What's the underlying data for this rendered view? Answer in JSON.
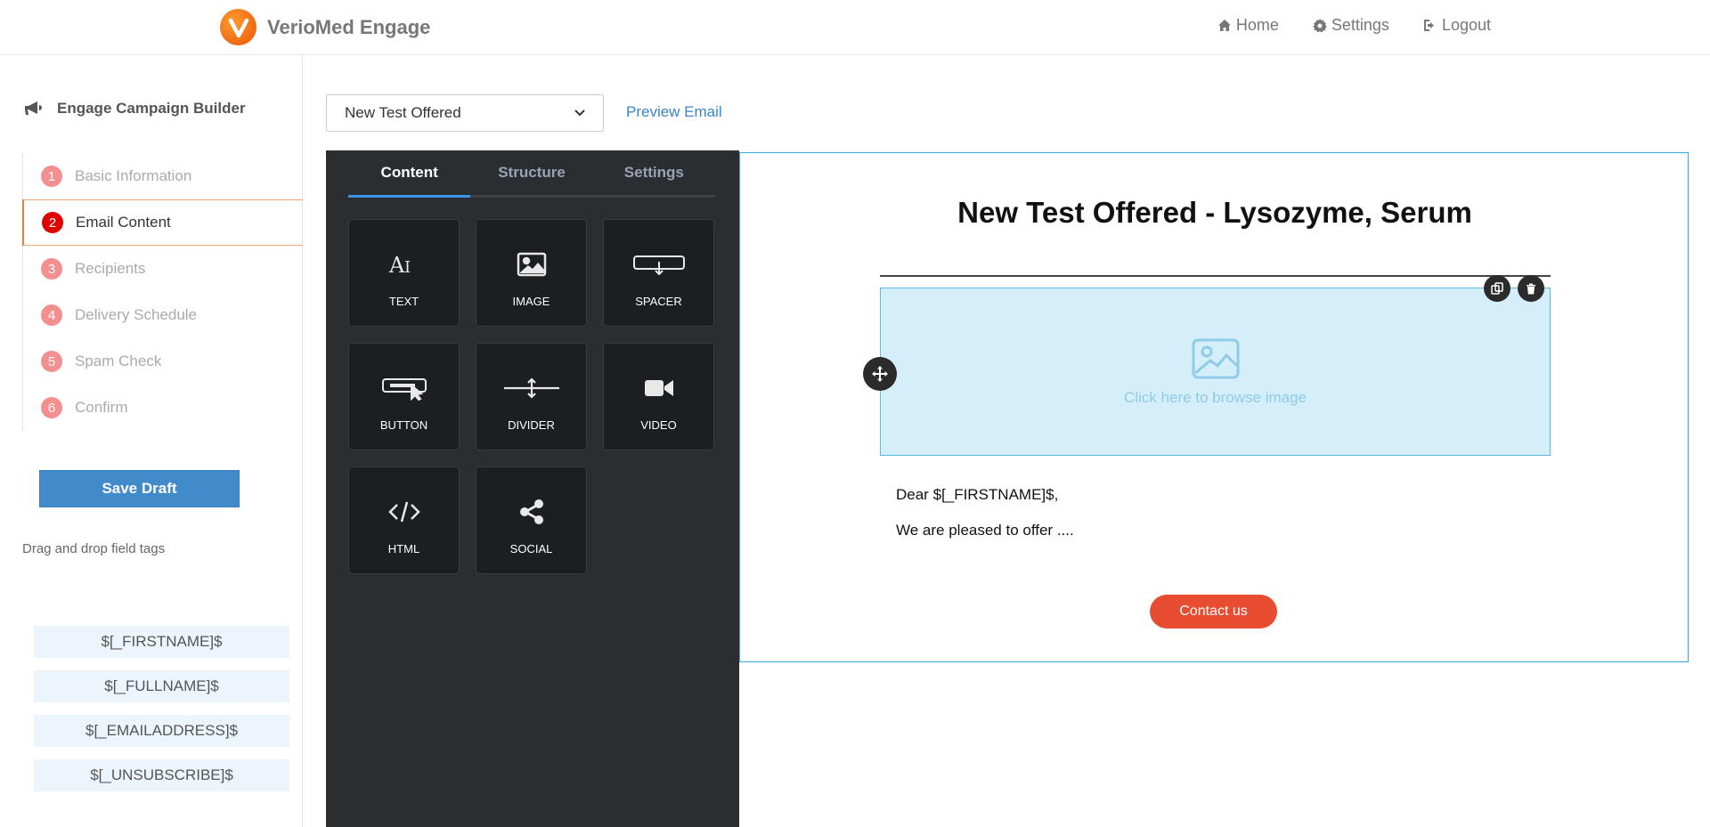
{
  "header": {
    "brand_name": "VerioMed Engage",
    "nav": [
      {
        "label": "Home",
        "icon": "home-icon"
      },
      {
        "label": "Settings",
        "icon": "gear-icon"
      },
      {
        "label": "Logout",
        "icon": "logout-icon"
      }
    ]
  },
  "sidebar": {
    "title": "Engage Campaign Builder",
    "title_icon": "megaphone-icon",
    "steps": [
      {
        "num": "1",
        "label": "Basic Information",
        "active": false
      },
      {
        "num": "2",
        "label": "Email Content",
        "active": true
      },
      {
        "num": "3",
        "label": "Recipients",
        "active": false
      },
      {
        "num": "4",
        "label": "Delivery Schedule",
        "active": false
      },
      {
        "num": "5",
        "label": "Spam Check",
        "active": false
      },
      {
        "num": "6",
        "label": "Confirm",
        "active": false
      }
    ],
    "save_label": "Save Draft",
    "tags_label": "Drag and drop field tags",
    "tags": [
      "$[_FIRSTNAME]$",
      "$[_FULLNAME]$",
      "$[_EMAILADDRESS]$",
      "$[_UNSUBSCRIBE]$"
    ]
  },
  "toolbar": {
    "template_selected": "New Test Offered",
    "preview_label": "Preview Email"
  },
  "builder": {
    "tabs": [
      {
        "label": "Content",
        "active": true
      },
      {
        "label": "Structure",
        "active": false
      },
      {
        "label": "Settings",
        "active": false
      }
    ],
    "blocks": [
      {
        "label": "TEXT",
        "icon": "text-icon"
      },
      {
        "label": "IMAGE",
        "icon": "image-icon"
      },
      {
        "label": "SPACER",
        "icon": "spacer-icon"
      },
      {
        "label": "BUTTON",
        "icon": "button-icon"
      },
      {
        "label": "DIVIDER",
        "icon": "divider-icon"
      },
      {
        "label": "VIDEO",
        "icon": "video-icon"
      },
      {
        "label": "HTML",
        "icon": "code-icon"
      },
      {
        "label": "SOCIAL",
        "icon": "share-icon"
      }
    ]
  },
  "email": {
    "title": "New Test Offered - Lysozyme, Serum",
    "image_placeholder": "Click here to browse image",
    "greeting": "Dear $[_FIRSTNAME]$,",
    "body": "We are pleased to offer ....",
    "button_label": "Contact us"
  },
  "colors": {
    "accent": "#428bca",
    "panel_bg": "#2b2d31",
    "canvas_border": "#35a8d8",
    "cta": "#e84d32",
    "active_step": "#e00000"
  }
}
